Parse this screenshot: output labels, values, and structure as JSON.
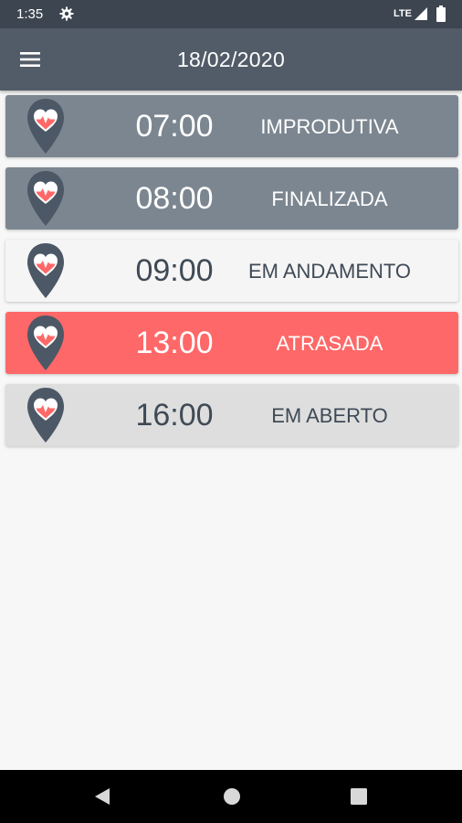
{
  "status_bar": {
    "time": "1:35",
    "network": "LTE",
    "icons": [
      "gear-icon",
      "signal-icon",
      "battery-icon"
    ]
  },
  "app_bar": {
    "title": "18/02/2020",
    "menu_icon": "hamburger-menu-icon"
  },
  "visits": [
    {
      "time": "07:00",
      "status": "IMPRODUTIVA",
      "bg": "#7c8690",
      "text_color": "#ffffff",
      "time_color": "#ffffff"
    },
    {
      "time": "08:00",
      "status": "FINALIZADA",
      "bg": "#7c8690",
      "text_color": "#ffffff",
      "time_color": "#ffffff"
    },
    {
      "time": "09:00",
      "status": "EM ANDAMENTO",
      "bg": "#f5f5f5",
      "text_color": "#3f4a56",
      "time_color": "#3f4a56"
    },
    {
      "time": "13:00",
      "status": "ATRASADA",
      "bg": "#ff6868",
      "text_color": "#ffffff",
      "time_color": "#ffffff"
    },
    {
      "time": "16:00",
      "status": "EM ABERTO",
      "bg": "#dedede",
      "text_color": "#3f4a56",
      "time_color": "#3f4a56"
    }
  ],
  "pin_icon": "location-pin-heart-icon",
  "colors": {
    "status_bar": "#3c4550",
    "app_bar": "#525c68",
    "pin": "#4d5866",
    "heart": "#ff6868",
    "background": "#f7f7f7"
  },
  "nav_bar": {
    "icons": [
      "back-icon",
      "home-icon",
      "recents-icon"
    ]
  }
}
